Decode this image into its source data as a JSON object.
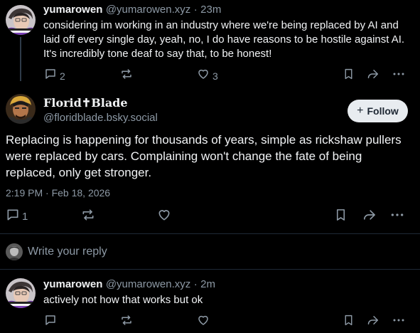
{
  "post1": {
    "author_name": "yumarowen",
    "author_handle": "@yumarowen.xyz",
    "separator": "·",
    "time_ago": "23m",
    "text": "considering im working in an industry where we're being replaced by AI and laid off every single day, yeah, no, I do have reasons to be hostile against AI. It's incredibly tone deaf to say that, to be honest!",
    "reply_count": "2",
    "like_count": "3"
  },
  "main_post": {
    "author_name": "Florid✝Blade",
    "author_handle": "@floridblade.bsky.social",
    "follow_label": "Follow",
    "follow_plus": "+",
    "text": "Replacing is happening for thousands of years, simple as rickshaw pullers were replaced by cars. Complaining won't change the fate of being replaced, only get stronger.",
    "timestamp": "2:19 PM · Feb 18, 2026",
    "reply_count": "1"
  },
  "composer": {
    "placeholder": "Write your reply"
  },
  "post3": {
    "author_name": "yumarowen",
    "author_handle": "@yumarowen.xyz",
    "separator": "·",
    "time_ago": "2m",
    "text": "actively not how that works but ok"
  },
  "colors": {
    "background": "#000000",
    "text_primary": "#f1f3f5",
    "text_secondary": "#8d99a5",
    "divider": "#1e2936",
    "follow_bg": "#e8ecf0"
  },
  "icons": [
    "reply-icon",
    "repost-icon",
    "like-icon",
    "bookmark-icon",
    "share-icon",
    "more-icon"
  ]
}
